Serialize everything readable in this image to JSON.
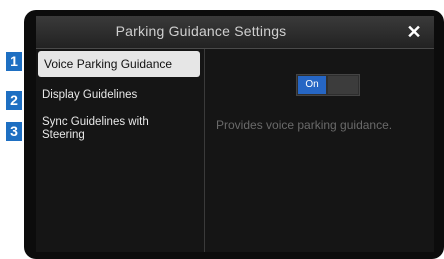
{
  "dialog": {
    "title": "Parking Guidance Settings",
    "close_icon": "close-icon"
  },
  "menu": {
    "items": [
      {
        "label": "Voice Parking Guidance",
        "selected": true
      },
      {
        "label": "Display Guidelines",
        "selected": false
      },
      {
        "label": "Sync Guidelines with Steering",
        "selected": false
      }
    ]
  },
  "detail": {
    "toggle_label": "On",
    "toggle_state": true,
    "description": "Provides voice parking guidance."
  },
  "callouts": [
    "1",
    "2",
    "3"
  ],
  "colors": {
    "accent": "#2666c4",
    "badge": "#1e6fc2",
    "selected_bg": "#e6e6e6"
  }
}
